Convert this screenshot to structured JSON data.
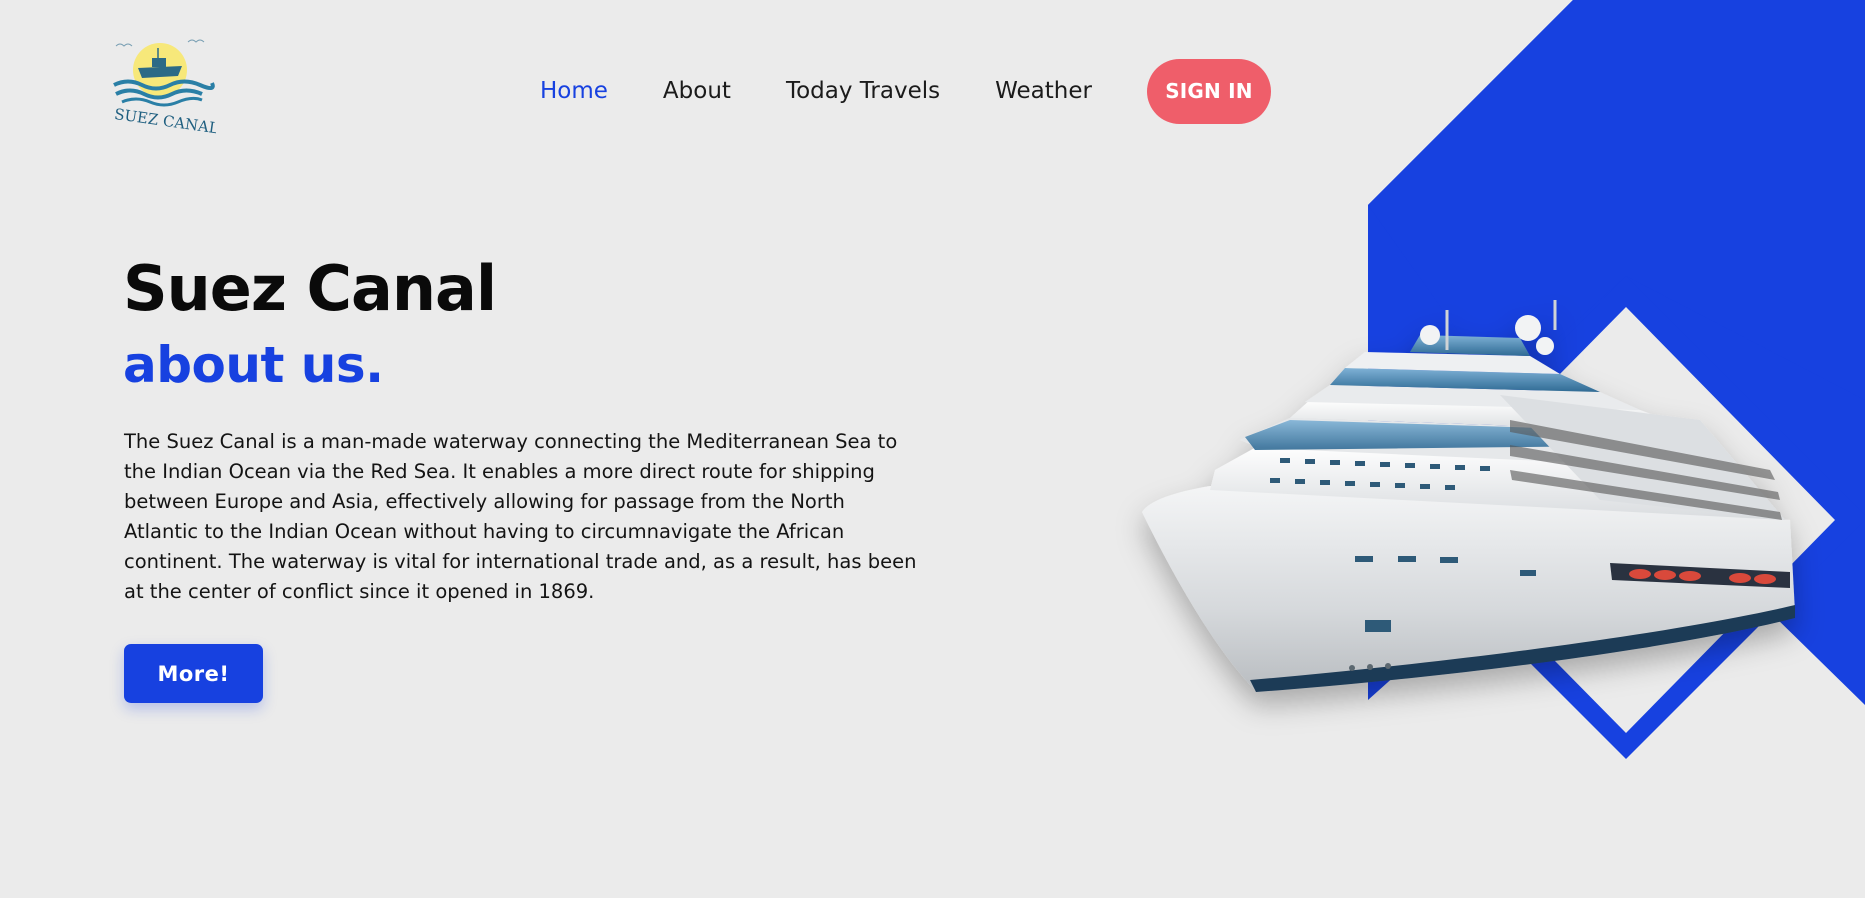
{
  "logo": {
    "text": "SUEZ CANAL",
    "icon": "ship-on-waves-logo"
  },
  "nav": {
    "items": [
      {
        "label": "Home",
        "active": true
      },
      {
        "label": "About",
        "active": false
      },
      {
        "label": "Today Travels",
        "active": false
      },
      {
        "label": "Weather",
        "active": false
      }
    ],
    "signin_label": "SIGN IN"
  },
  "hero": {
    "title": "Suez Canal",
    "subtitle": "about us.",
    "description": "The Suez Canal is a man-made waterway connecting the Mediterranean Sea to the Indian Ocean via the Red Sea. It enables a more direct route for shipping between Europe and Asia, effectively allowing for passage from the North Atlantic to the Indian Ocean without having to circumnavigate the African continent. The waterway is vital for international trade and, as a result, has been at the center of conflict since it opened in 1869.",
    "more_label": "More!"
  },
  "illustration": {
    "icon": "cruise-ship-illustration"
  },
  "colors": {
    "background": "#ebebeb",
    "accent_blue": "#1741e0",
    "signin_red": "#ef5e6a",
    "text_dark": "#0a0a0a"
  }
}
